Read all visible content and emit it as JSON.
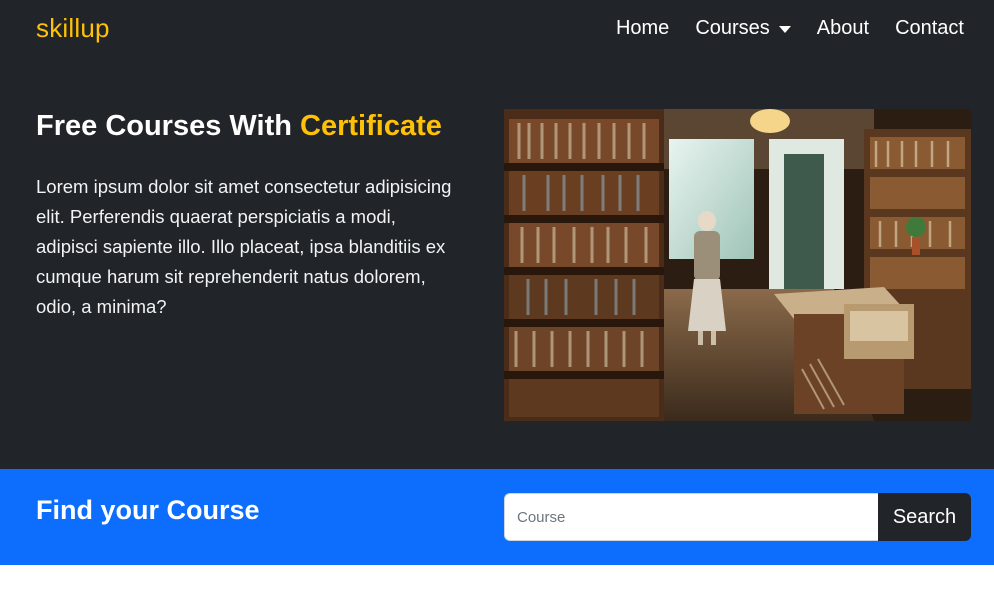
{
  "navbar": {
    "brand": "skillup",
    "links": [
      {
        "label": "Home"
      },
      {
        "label": "Courses"
      },
      {
        "label": "About"
      },
      {
        "label": "Contact"
      }
    ]
  },
  "hero": {
    "title_main": "Free Courses With ",
    "title_accent": "Certificate",
    "paragraph": "Lorem ipsum dolor sit amet consectetur adipisicing elit. Perferendis quaerat perspiciatis a modi, adipisci sapiente illo. Illo placeat, ipsa blanditiis ex cumque harum sit reprehenderit natus dolorem, odio, a minima?"
  },
  "search": {
    "title": "Find your Course",
    "placeholder": "Course",
    "value": "",
    "button_label": "Search"
  },
  "colors": {
    "dark": "#212529",
    "accent": "#ffc107",
    "primary": "#0d6efd"
  },
  "icons": {
    "dropdown": "caret-down-icon"
  }
}
